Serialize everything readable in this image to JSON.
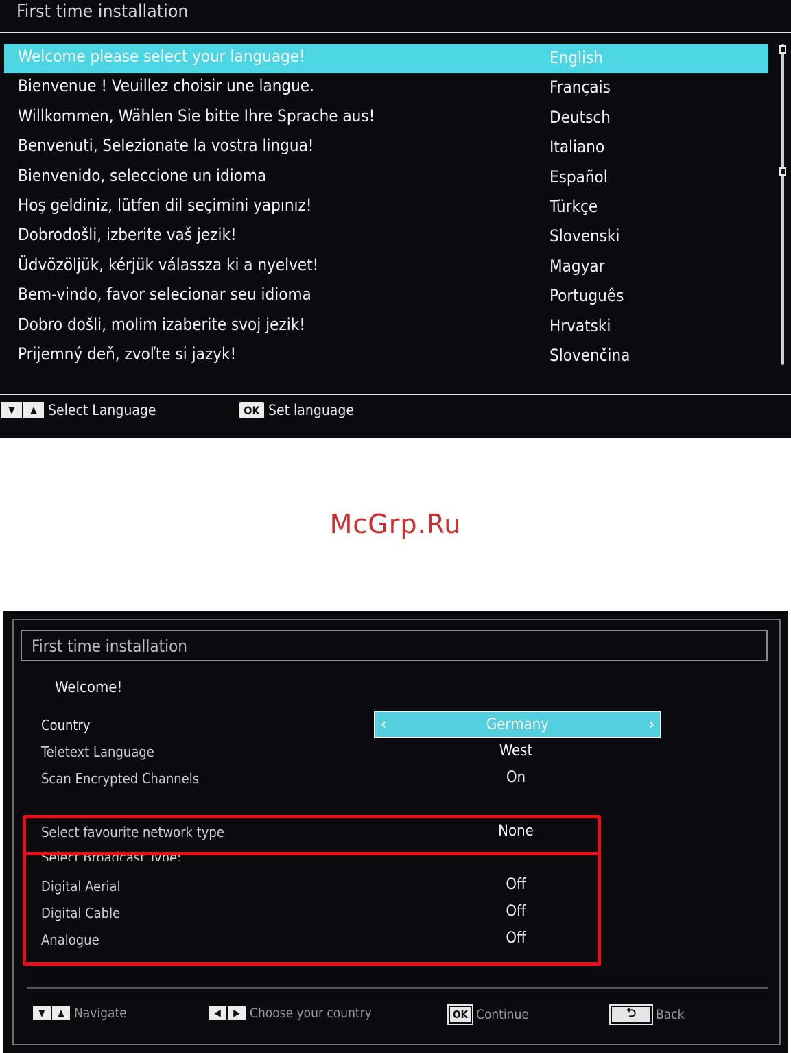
{
  "screen1": {
    "title": "First time installation",
    "languages": [
      {
        "greeting": "Welcome please select your language!",
        "name": "English",
        "selected": true
      },
      {
        "greeting": "Bienvenue ! Veuillez choisir une langue.",
        "name": "Français"
      },
      {
        "greeting": "Willkommen, Wählen Sie bitte Ihre Sprache aus!",
        "name": "Deutsch"
      },
      {
        "greeting": "Benvenuti, Selezionate la vostra lingua!",
        "name": "Italiano"
      },
      {
        "greeting": "Bienvenido, seleccione un idioma",
        "name": "Español"
      },
      {
        "greeting": "Hoş geldiniz, lütfen dil seçimini yapınız!",
        "name": "Türkçe"
      },
      {
        "greeting": "Dobrodošli, izberite vaš jezik!",
        "name": "Slovenski"
      },
      {
        "greeting": "Üdvözöljük, kérjük válassza ki a nyelvet!",
        "name": "Magyar"
      },
      {
        "greeting": "Bem-vindo, favor selecionar seu idioma",
        "name": "Português"
      },
      {
        "greeting": "Dobro došli, molim izaberite svoj jezik!",
        "name": "Hrvatski"
      },
      {
        "greeting": "Prijemný deň, zvoľte si jazyk!",
        "name": "Slovenčina"
      }
    ],
    "footer": {
      "select_label": "Select Language",
      "ok_key": "OK",
      "set_label": "Set language"
    }
  },
  "watermark": "McGrp.Ru",
  "screen2": {
    "title": "First time installation",
    "welcome": "Welcome!",
    "settings": {
      "country": {
        "label": "Country",
        "value": "Germany"
      },
      "teletext": {
        "label": "Teletext Language",
        "value": "West"
      },
      "scan_encrypted": {
        "label": "Scan Encrypted Channels",
        "value": "On"
      },
      "favourite_network": {
        "label": "Select favourite network type",
        "value": "None"
      },
      "broadcast_type": {
        "label": "Select Broadcast Type:"
      },
      "digital_aerial": {
        "label": "Digital Aerial",
        "value": "Off"
      },
      "digital_cable": {
        "label": "Digital Cable",
        "value": "Off"
      },
      "analogue": {
        "label": "Analogue",
        "value": "Off"
      }
    },
    "footer": {
      "navigate_label": "Navigate",
      "choose_label": "Choose your country",
      "ok_key": "OK",
      "continue_label": "Continue",
      "back_label": "Back"
    },
    "highlight_color": "#e8101a"
  }
}
